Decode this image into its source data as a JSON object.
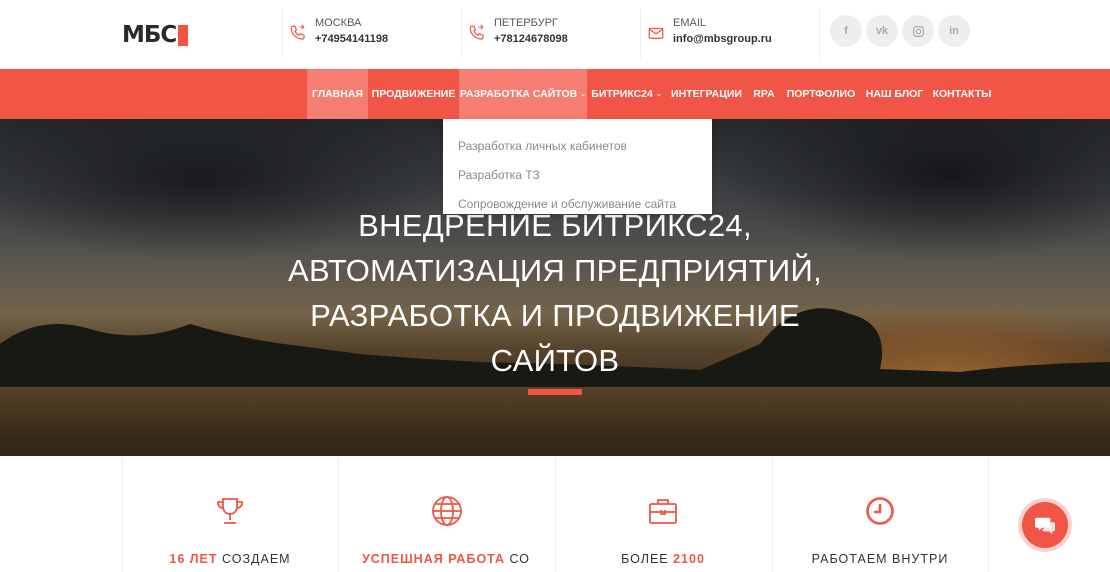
{
  "brand": {
    "logo_text": "МБС",
    "accent": "#f05546"
  },
  "contacts": [
    {
      "label": "МОСКВА",
      "value": "+74954141198",
      "icon": "phone-icon"
    },
    {
      "label": "ПЕТЕРБУРГ",
      "value": "+78124678098",
      "icon": "phone-icon"
    },
    {
      "label": "EMAIL",
      "value": "info@mbsgroup.ru",
      "icon": "mail-icon"
    }
  ],
  "social": [
    "f",
    "vk",
    "ig",
    "in"
  ],
  "nav": [
    {
      "label": "ГЛАВНАЯ",
      "active": true
    },
    {
      "label": "ПРОДВИЖЕНИЕ"
    },
    {
      "label": "РАЗРАБОТКА САЙТОВ",
      "has_dropdown": true,
      "open": true
    },
    {
      "label": "БИТРИКС24",
      "has_dropdown": true
    },
    {
      "label": "ИНТЕГРАЦИИ"
    },
    {
      "label": "RPA"
    },
    {
      "label": "ПОРТФОЛИО"
    },
    {
      "label": "НАШ БЛОГ"
    },
    {
      "label": "КОНТАКТЫ"
    }
  ],
  "nav_caret": "⌄",
  "dropdown": {
    "items": [
      "Разработка личных кабинетов",
      "Разработка ТЗ",
      "Сопровождение и обслуживание сайта"
    ]
  },
  "hero": {
    "lines": [
      "ВНЕДРЕНИЕ БИТРИКС24,",
      "АВТОМАТИЗАЦИЯ ПРЕДПРИЯТИЙ,",
      "РАЗРАБОТКА И ПРОДВИЖЕНИЕ",
      "САЙТОВ"
    ]
  },
  "features": [
    {
      "icon": "trophy-icon",
      "accent": "16 ЛЕТ",
      "text": " СОЗДАЕМ"
    },
    {
      "icon": "globe-icon",
      "accent": "УСПЕШНАЯ РАБОТА",
      "text": " СО"
    },
    {
      "icon": "briefcase-icon",
      "accent": "",
      "text": "БОЛЕЕ ",
      "accent_after": "2100"
    },
    {
      "icon": "clock-icon",
      "accent": "",
      "text": "РАБОТАЕМ ВНУТРИ"
    }
  ]
}
